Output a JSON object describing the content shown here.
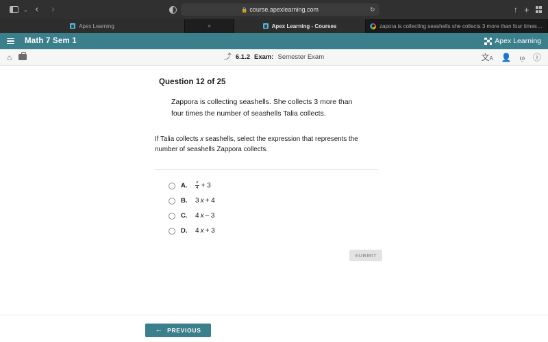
{
  "browser": {
    "sidebar_icon": "sidebar-toggle-icon",
    "sidebar_chevron": "⌄",
    "back_arrow": "‹",
    "forward_arrow": "›",
    "privacy_icon": "privacy-report-icon",
    "lock_glyph": "🔒",
    "url": "course.apexlearning.com",
    "reload_glyph": "↻",
    "share_glyph": "↑",
    "plus_glyph": "+",
    "tabs": [
      {
        "label": "Apex Learning",
        "favicon": "apex-favicon"
      },
      {
        "label": "Apex Learning - Courses",
        "favicon": "apex-favicon"
      },
      {
        "label": "zapora is collecting seashells she collects 3 more than four times the number o…",
        "favicon": "google-favicon"
      }
    ],
    "close_glyph": "×"
  },
  "app_header": {
    "menu_icon": "hamburger-menu-icon",
    "course_title": "Math 7 Sem 1",
    "brand_name": "Apex Learning"
  },
  "subnav": {
    "home_glyph": "⌂",
    "briefcase_icon": "briefcase-icon",
    "up_glyph": "⤴",
    "lesson_number": "6.1.2",
    "activity_type": "Exam:",
    "activity_name": "Semester Exam",
    "translate_glyph": "文A",
    "read_aloud_glyph": "👤",
    "print_glyph": "⎙",
    "help_glyph": "?"
  },
  "question": {
    "heading": "Question 12 of 25",
    "stem_line_1": "Zappora is collecting seashells. She collects 3 more than",
    "stem_line_2": "four times the number of seashells Talia collects.",
    "prompt_part_1": "If Talia collects ",
    "prompt_variable": "x",
    "prompt_part_2": " seashells, select the expression that represents the number of seashells Zappora collects.",
    "options": [
      {
        "letter": "A.",
        "type": "fraction",
        "numerator": "x",
        "denominator": "4",
        "tail": "+ 3"
      },
      {
        "letter": "B.",
        "type": "plain",
        "coefficient": "3",
        "variable": "x",
        "tail": "+ 4"
      },
      {
        "letter": "C.",
        "type": "plain",
        "coefficient": "4",
        "variable": "x",
        "tail": "– 3"
      },
      {
        "letter": "D.",
        "type": "plain",
        "coefficient": "4",
        "variable": "x",
        "tail": "+ 3"
      }
    ],
    "submit_label": "SUBMIT"
  },
  "footer": {
    "previous_label": "PREVIOUS",
    "previous_arrow": "←"
  },
  "colors": {
    "brand_teal": "#3c7f8c",
    "chrome_dark": "#303030",
    "tab_dark": "#1e1e1e"
  }
}
